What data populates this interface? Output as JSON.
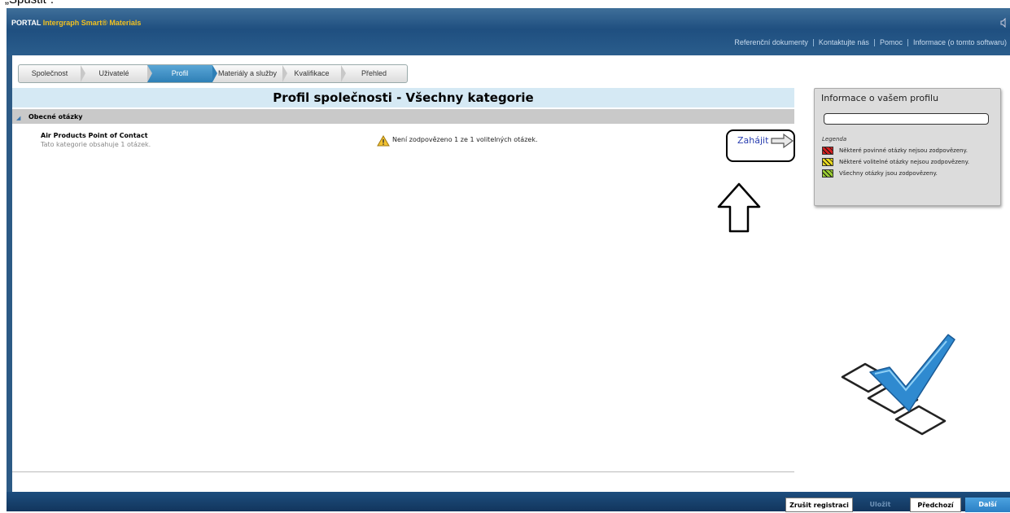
{
  "caption": "„Spustit“.",
  "header": {
    "brand_portal": "PORTAL",
    "brand_product": "Intergraph Smart® Materials",
    "nav": [
      {
        "label": "Referenční dokumenty"
      },
      {
        "label": "Kontaktujte nás"
      },
      {
        "label": "Pomoc"
      },
      {
        "label": "Informace (o tomto softwaru)"
      }
    ]
  },
  "tabs": [
    {
      "label": "Společnost",
      "active": false
    },
    {
      "label": "Uživatelé",
      "active": false
    },
    {
      "label": "Profil",
      "active": true
    },
    {
      "label": "Materiály a služby",
      "active": false
    },
    {
      "label": "Kvalifikace",
      "active": false
    },
    {
      "label": "Přehled",
      "active": false
    }
  ],
  "main": {
    "title": "Profil společnosti - Všechny kategorie",
    "section": "Obecné otázky",
    "category": {
      "title": "Air Products Point of Contact",
      "subtitle": "Tato kategorie obsahuje 1 otázek.",
      "status": "Není zodpovězeno 1 ze 1 volitelných otázek.",
      "action": "Zahájit"
    }
  },
  "info_panel": {
    "title": "Informace o vašem profilu",
    "input_value": "",
    "legend_title": "Legenda",
    "legend": [
      {
        "label": "Některé povinné otázky nejsou zodpovězeny.",
        "color": "#d42020"
      },
      {
        "label": "Některé volitelné otázky nejsou zodpovězeny.",
        "color": "#e8d820"
      },
      {
        "label": "Všechny otázky jsou zodpovězeny.",
        "color": "#9acd32"
      }
    ]
  },
  "footer": {
    "cancel": "Zrušit registraci",
    "save": "Uložit",
    "previous": "Předchozí",
    "next": "Další"
  },
  "colors": {
    "header": "#1f4f80",
    "active_tab": "#2e7fb6",
    "title_bar": "#d5e9f4",
    "link": "#2a3fb0"
  },
  "icons": [
    "speaker-icon",
    "expand-triangle-icon",
    "warning-icon",
    "arrow-right-icon",
    "up-arrow-icon",
    "checklist-icon"
  ]
}
